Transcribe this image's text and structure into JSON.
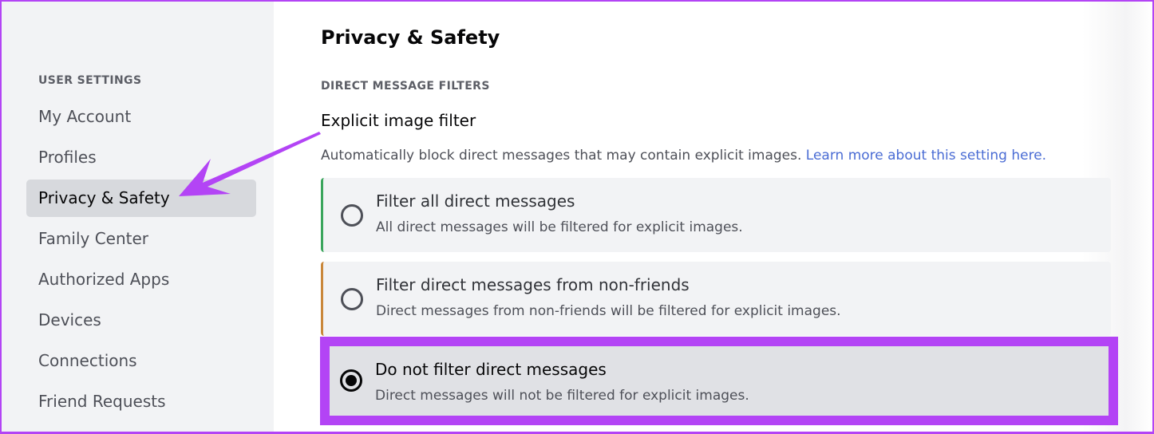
{
  "sidebar": {
    "section_label": "USER SETTINGS",
    "items": [
      {
        "label": "My Account",
        "active": false
      },
      {
        "label": "Profiles",
        "active": false
      },
      {
        "label": "Privacy & Safety",
        "active": true
      },
      {
        "label": "Family Center",
        "active": false
      },
      {
        "label": "Authorized Apps",
        "active": false
      },
      {
        "label": "Devices",
        "active": false
      },
      {
        "label": "Connections",
        "active": false
      },
      {
        "label": "Friend Requests",
        "active": false
      }
    ]
  },
  "main": {
    "title": "Privacy & Safety",
    "section_heading": "DIRECT MESSAGE FILTERS",
    "setting_title": "Explicit image filter",
    "setting_description": "Automatically block direct messages that may contain explicit images.",
    "learn_more_link": "Learn more about this setting here.",
    "options": [
      {
        "label": "Filter all direct messages",
        "description": "All direct messages will be filtered for explicit images.",
        "selected": false,
        "accent": "#3ba55c"
      },
      {
        "label": "Filter direct messages from non-friends",
        "description": "Direct messages from non-friends will be filtered for explicit images.",
        "selected": false,
        "accent": "#c9873a"
      },
      {
        "label": "Do not filter direct messages",
        "description": "Direct messages will not be filtered for explicit images.",
        "selected": true,
        "accent": null
      }
    ]
  },
  "annotation": {
    "highlight_color": "#b344f5",
    "arrow_icon": "arrow-pointing-to-privacy-safety"
  }
}
